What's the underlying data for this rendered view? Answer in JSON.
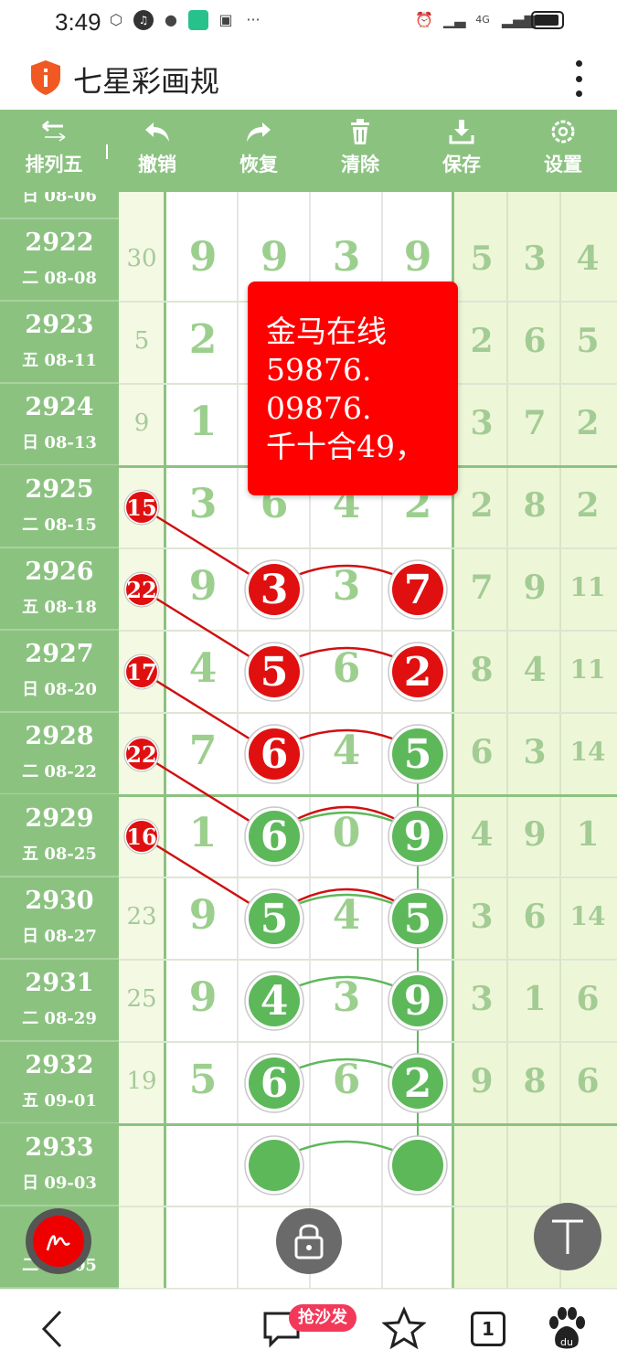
{
  "status_bar": {
    "time": "3:49",
    "network": "4G"
  },
  "app": {
    "title": "七星彩画规"
  },
  "toolbar": {
    "items": [
      {
        "label": "排列五",
        "icon": "swap-arrows-icon"
      },
      {
        "label": "撤销",
        "icon": "undo-icon"
      },
      {
        "label": "恢复",
        "icon": "redo-icon"
      },
      {
        "label": "清除",
        "icon": "trash-icon"
      },
      {
        "label": "保存",
        "icon": "download-icon"
      },
      {
        "label": "设置",
        "icon": "gear-icon"
      }
    ]
  },
  "grid": {
    "partial_top_date": "日 08-06",
    "rows": [
      {
        "issue": "2922",
        "date": "二 08-08",
        "sum": "30",
        "digits": [
          "9",
          "9",
          "3",
          "9"
        ],
        "right": [
          "5",
          "3",
          "4"
        ]
      },
      {
        "issue": "2923",
        "date": "五 08-11",
        "sum": "5",
        "digits": [
          "2",
          "",
          "",
          ""
        ],
        "right": [
          "2",
          "6",
          "5"
        ]
      },
      {
        "issue": "2924",
        "date": "日 08-13",
        "sum": "9",
        "digits": [
          "1",
          "",
          "",
          ""
        ],
        "right": [
          "3",
          "7",
          "2"
        ]
      },
      {
        "issue": "2925",
        "date": "二 08-15",
        "sum": "15",
        "digits": [
          "3",
          "6",
          "4",
          "2"
        ],
        "right": [
          "2",
          "8",
          "2"
        ]
      },
      {
        "issue": "2926",
        "date": "五 08-18",
        "sum": "22",
        "digits": [
          "9",
          "3",
          "3",
          "7"
        ],
        "right": [
          "7",
          "9",
          "11"
        ]
      },
      {
        "issue": "2927",
        "date": "日 08-20",
        "sum": "17",
        "digits": [
          "4",
          "5",
          "6",
          "2"
        ],
        "right": [
          "8",
          "4",
          "11"
        ]
      },
      {
        "issue": "2928",
        "date": "二 08-22",
        "sum": "22",
        "digits": [
          "7",
          "6",
          "4",
          "5"
        ],
        "right": [
          "6",
          "3",
          "14"
        ]
      },
      {
        "issue": "2929",
        "date": "五 08-25",
        "sum": "16",
        "digits": [
          "1",
          "6",
          "0",
          "9"
        ],
        "right": [
          "4",
          "9",
          "1"
        ]
      },
      {
        "issue": "2930",
        "date": "日 08-27",
        "sum": "23",
        "digits": [
          "9",
          "5",
          "4",
          "5"
        ],
        "right": [
          "3",
          "6",
          "14"
        ]
      },
      {
        "issue": "2931",
        "date": "二 08-29",
        "sum": "25",
        "digits": [
          "9",
          "4",
          "3",
          "9"
        ],
        "right": [
          "3",
          "1",
          "6"
        ]
      },
      {
        "issue": "2932",
        "date": "五 09-01",
        "sum": "19",
        "digits": [
          "5",
          "6",
          "6",
          "2"
        ],
        "right": [
          "9",
          "8",
          "6"
        ]
      },
      {
        "issue": "2933",
        "date": "日 09-03",
        "sum": "",
        "digits": [
          "",
          "",
          "",
          ""
        ],
        "right": [
          "",
          "",
          ""
        ]
      },
      {
        "issue": "",
        "date": "二 09-05",
        "sum": "",
        "digits": [
          "",
          "",
          "",
          ""
        ],
        "right": [
          "",
          "",
          ""
        ]
      }
    ],
    "red_sum_rows": [
      3,
      4,
      5,
      6,
      7
    ],
    "red_circles": [
      {
        "row": 4,
        "col": 1,
        "value": "3"
      },
      {
        "row": 4,
        "col": 3,
        "value": "7"
      },
      {
        "row": 5,
        "col": 1,
        "value": "5"
      },
      {
        "row": 5,
        "col": 3,
        "value": "2"
      },
      {
        "row": 6,
        "col": 1,
        "value": "6"
      }
    ],
    "green_circles": [
      {
        "row": 6,
        "col": 3,
        "value": "5"
      },
      {
        "row": 7,
        "col": 1,
        "value": "6"
      },
      {
        "row": 7,
        "col": 3,
        "value": "9"
      },
      {
        "row": 8,
        "col": 1,
        "value": "5"
      },
      {
        "row": 8,
        "col": 3,
        "value": "5"
      },
      {
        "row": 9,
        "col": 1,
        "value": "4"
      },
      {
        "row": 9,
        "col": 3,
        "value": "9"
      },
      {
        "row": 10,
        "col": 1,
        "value": "6"
      },
      {
        "row": 10,
        "col": 3,
        "value": "2"
      },
      {
        "row": 11,
        "col": 1,
        "value": ""
      },
      {
        "row": 11,
        "col": 3,
        "value": ""
      }
    ]
  },
  "card": {
    "lines": [
      "金马在线",
      "59876.",
      "09876.",
      "千十合49，"
    ],
    "color": "#ff0000"
  },
  "colors": {
    "toolbar_green": "#8bc280",
    "light_green_bg": "#eef6d8",
    "red": "#e01010",
    "green": "#5db85a"
  },
  "bottom_nav": {
    "badge": "抢沙发",
    "tab_count": "1"
  }
}
